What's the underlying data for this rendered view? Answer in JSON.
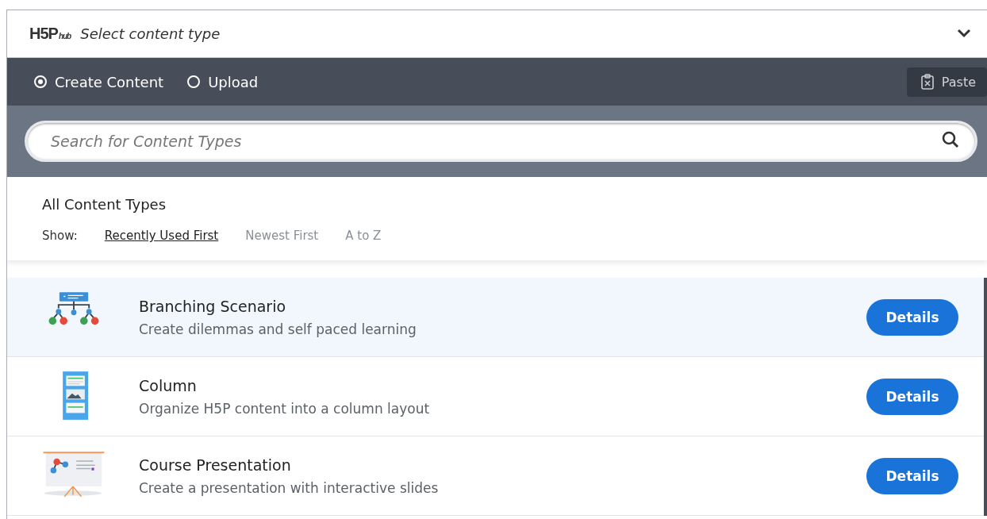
{
  "header": {
    "logo": "H5P",
    "logo_sub": "hub",
    "title": "Select content type",
    "expanded": true
  },
  "modes": [
    {
      "label": "Create Content",
      "selected": true
    },
    {
      "label": "Upload",
      "selected": false
    }
  ],
  "paste_button": "Paste",
  "search": {
    "placeholder": "Search for Content Types"
  },
  "section_title": "All Content Types",
  "sort": {
    "label": "Show:",
    "options": [
      {
        "label": "Recently Used First",
        "selected": true
      },
      {
        "label": "Newest First",
        "selected": false
      },
      {
        "label": "A to Z",
        "selected": false
      }
    ]
  },
  "items": [
    {
      "kind": "branching",
      "title": "Branching Scenario",
      "summary": "Create dilemmas and self paced learning",
      "button": "Details",
      "selected": true
    },
    {
      "kind": "column",
      "title": "Column",
      "summary": "Organize H5P content into a column layout",
      "button": "Details",
      "selected": false
    },
    {
      "kind": "presentation",
      "title": "Course Presentation",
      "summary": "Create a presentation with interactive slides",
      "button": "Details",
      "selected": false
    }
  ]
}
